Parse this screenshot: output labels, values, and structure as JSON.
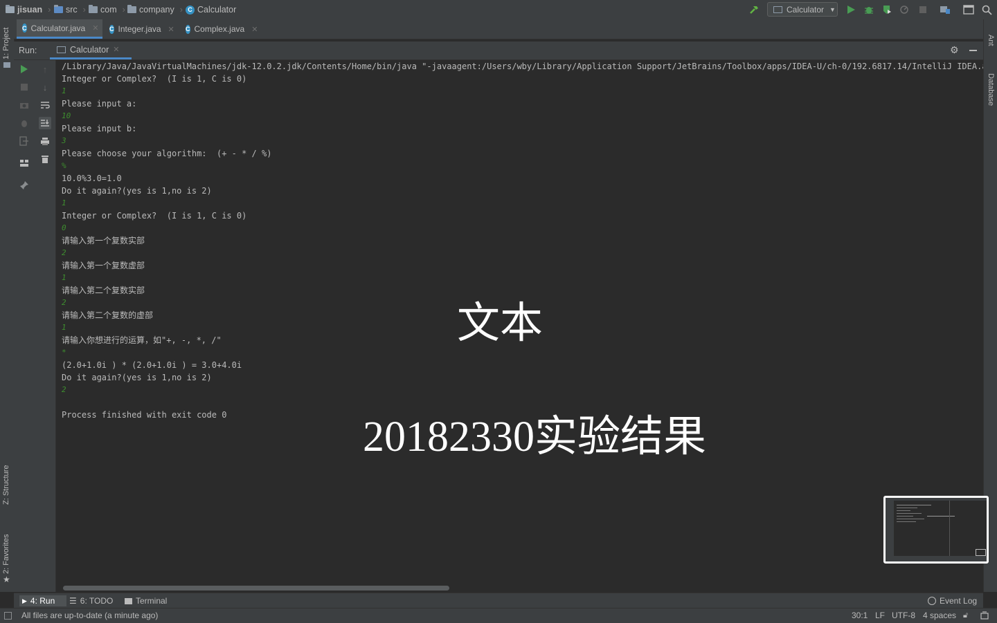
{
  "breadcrumb": {
    "project": "jisuan",
    "items": [
      "src",
      "com",
      "company",
      "Calculator"
    ]
  },
  "toolbar": {
    "run_config": "Calculator",
    "icons": [
      "build-hammer-icon",
      "run-icon",
      "debug-icon",
      "coverage-icon",
      "profile-icon",
      "stop-icon",
      "project-structure-icon",
      "window-icon",
      "search-icon"
    ]
  },
  "left_strip": {
    "project": "1: Project",
    "structure": "Z: Structure",
    "favorites": "2: Favorites"
  },
  "right_strip": {
    "ant": "Ant",
    "database": "Database"
  },
  "editor_tabs": [
    {
      "label": "Calculator.java",
      "active": true
    },
    {
      "label": "Integer.java",
      "active": false
    },
    {
      "label": "Complex.java",
      "active": false
    }
  ],
  "run_panel": {
    "label": "Run:",
    "tab": "Calculator"
  },
  "console": {
    "lines": [
      {
        "text": "/Library/Java/JavaVirtualMachines/jdk-12.0.2.jdk/Contents/Home/bin/java \"-javaagent:/Users/wby/Library/Application Support/JetBrains/Toolbox/apps/IDEA-U/ch-0/192.6817.14/IntelliJ IDEA.app/Co",
        "input": false
      },
      {
        "text": "Integer or Complex?  (I is 1, C is 0)",
        "input": false
      },
      {
        "text": "1",
        "input": true
      },
      {
        "text": "Please input a:",
        "input": false
      },
      {
        "text": "10",
        "input": true
      },
      {
        "text": "Please input b:",
        "input": false
      },
      {
        "text": "3",
        "input": true
      },
      {
        "text": "Please choose your algorithm:  (+ - * / %)",
        "input": false
      },
      {
        "text": "%",
        "input": true
      },
      {
        "text": "10.0%3.0=1.0",
        "input": false
      },
      {
        "text": "Do it again?(yes is 1,no is 2)",
        "input": false
      },
      {
        "text": "1",
        "input": true
      },
      {
        "text": "Integer or Complex?  (I is 1, C is 0)",
        "input": false
      },
      {
        "text": "0",
        "input": true
      },
      {
        "text": "请输入第一个复数实部",
        "input": false
      },
      {
        "text": "2",
        "input": true
      },
      {
        "text": "请输入第一个复数虚部",
        "input": false
      },
      {
        "text": "1",
        "input": true
      },
      {
        "text": "请输入第二个复数实部",
        "input": false
      },
      {
        "text": "2",
        "input": true
      },
      {
        "text": "请输入第二个复数的虚部",
        "input": false
      },
      {
        "text": "1",
        "input": true
      },
      {
        "text": "请输入你想进行的运算，如\"+, -, *, /\"",
        "input": false
      },
      {
        "text": "*",
        "input": true
      },
      {
        "text": "(2.0+1.0i ) * (2.0+1.0i ) = 3.0+4.0i",
        "input": false
      },
      {
        "text": "Do it again?(yes is 1,no is 2)",
        "input": false
      },
      {
        "text": "2",
        "input": true
      },
      {
        "text": "",
        "input": false
      },
      {
        "text": "Process finished with exit code 0",
        "input": false
      }
    ]
  },
  "overlay": {
    "line1": "文本",
    "line2": "20182330实验结果"
  },
  "bottom_tools": {
    "run": "4: Run",
    "todo": "6: TODO",
    "terminal": "Terminal",
    "event_log": "Event Log"
  },
  "status": {
    "message": "All files are up-to-date (a minute ago)",
    "position": "30:1",
    "line_sep": "LF",
    "encoding": "UTF-8",
    "indent": "4 spaces"
  },
  "colors": {
    "accent": "#4a88c7",
    "input_text": "#3e8d2f",
    "run_green": "#499c54"
  }
}
